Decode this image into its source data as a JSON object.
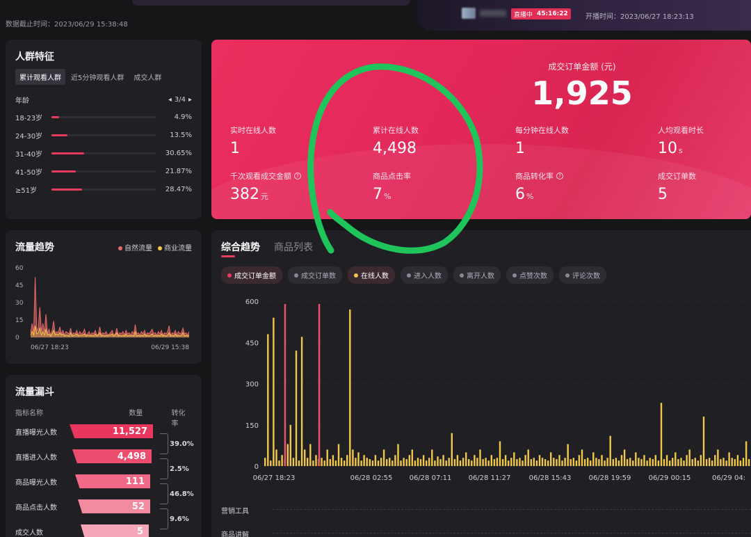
{
  "header": {
    "cutoff_time": "数据截止时间：2023/06/29 15:38:48",
    "live_status": "直播中",
    "live_timer": "45:16:22",
    "start_time": "开播时间：2023/06/27 18:23:13"
  },
  "crowd": {
    "title": "人群特征",
    "tabs": [
      "累计观看人群",
      "近5分钟观看人群",
      "成交人群"
    ],
    "active_tab": 0,
    "section_label": "年龄",
    "pager": "3/4",
    "rows": [
      {
        "label": "18-23岁",
        "pct": "4.9%",
        "value": 4.9
      },
      {
        "label": "24-30岁",
        "pct": "13.5%",
        "value": 13.5
      },
      {
        "label": "31-40岁",
        "pct": "30.65%",
        "value": 30.65
      },
      {
        "label": "41-50岁",
        "pct": "21.87%",
        "value": 21.87
      },
      {
        "label": "≥51岁",
        "pct": "28.47%",
        "value": 28.47
      }
    ]
  },
  "hero": {
    "big_label": "成交订单金额 (元)",
    "big_value": "1,925",
    "metrics": [
      {
        "label": "实时在线人数",
        "value": "1",
        "unit": "",
        "help": false
      },
      {
        "label": "累计在线人数",
        "value": "4,498",
        "unit": "",
        "help": false
      },
      {
        "label": "每分钟在线人数",
        "value": "1",
        "unit": "",
        "help": false
      },
      {
        "label": "人均观看时长",
        "value": "10",
        "unit": "s",
        "help": false
      },
      {
        "label": "千次观看成交金额",
        "value": "382",
        "unit": "元",
        "help": true
      },
      {
        "label": "商品点击率",
        "value": "7",
        "unit": "%",
        "help": false
      },
      {
        "label": "商品转化率",
        "value": "6",
        "unit": "%",
        "help": true
      },
      {
        "label": "成交订单数",
        "value": "5",
        "unit": "",
        "help": false
      }
    ]
  },
  "traffic": {
    "title": "流量趋势",
    "legend": [
      {
        "name": "自然流量",
        "color": "#e86a6a"
      },
      {
        "name": "商业流量",
        "color": "#f2c84b"
      }
    ],
    "x_start": "06/27 18:23",
    "x_end": "06/29 15:38"
  },
  "funnel": {
    "title": "流量漏斗",
    "col_name": "指标名称",
    "col_count": "数量",
    "col_rate": "转化率",
    "rows": [
      {
        "name": "直播曝光人数",
        "value": "11,527"
      },
      {
        "name": "直播进入人数",
        "value": "4,498"
      },
      {
        "name": "商品曝光人数",
        "value": "111"
      },
      {
        "name": "商品点击人数",
        "value": "52"
      },
      {
        "name": "成交人数",
        "value": "5"
      }
    ],
    "rates": [
      "39.0%",
      "2.5%",
      "46.8%",
      "9.6%"
    ]
  },
  "main": {
    "tabs": [
      "综合趋势",
      "商品列表"
    ],
    "chips": [
      {
        "label": "成交订单金额",
        "color": "#e83b5d",
        "selected": true
      },
      {
        "label": "成交订单数",
        "color": "#8a8a93",
        "selected": false
      },
      {
        "label": "在线人数",
        "color": "#f2c84b",
        "selected": true
      },
      {
        "label": "进入人数",
        "color": "#8a8a93",
        "selected": false
      },
      {
        "label": "离开人数",
        "color": "#8a8a93",
        "selected": false
      },
      {
        "label": "点赞次数",
        "color": "#8a8a93",
        "selected": false
      },
      {
        "label": "评论次数",
        "color": "#8a8a93",
        "selected": false
      }
    ],
    "bottom_rows": [
      "营销工具",
      "商品讲解"
    ]
  },
  "chart_data": [
    {
      "type": "line",
      "title": "流量趋势",
      "ylim": [
        0,
        60
      ],
      "y_ticks": [
        "60",
        "45",
        "30",
        "15",
        "0"
      ],
      "x_labels": [
        "06/27 18:23",
        "06/29 15:38"
      ],
      "series": [
        {
          "name": "自然流量",
          "values": [
            4,
            12,
            3,
            52,
            6,
            8,
            26,
            5,
            12,
            4,
            20,
            3,
            7,
            2,
            6,
            14,
            3,
            5,
            4,
            9,
            3,
            6,
            2,
            5,
            4,
            3,
            8,
            2,
            4,
            3,
            6,
            2,
            5,
            3,
            4,
            7,
            2,
            3,
            5,
            2,
            4,
            3,
            6,
            2,
            3,
            9,
            2,
            4,
            3,
            5,
            2,
            3,
            4,
            6,
            2,
            3,
            8,
            2,
            4,
            3,
            5,
            2,
            6,
            3,
            4,
            2,
            5,
            3,
            11,
            3,
            4,
            2,
            5,
            3,
            6,
            2,
            4,
            3,
            5,
            7,
            3,
            4,
            2,
            5,
            3,
            6,
            2,
            4,
            3,
            5,
            10,
            2,
            4,
            3,
            6,
            2,
            5,
            3,
            4,
            8,
            3,
            4,
            2,
            5
          ]
        },
        {
          "name": "商业流量",
          "values": [
            2,
            5,
            2,
            10,
            3,
            4,
            8,
            2,
            5,
            2,
            7,
            2,
            3,
            1,
            3,
            6,
            2,
            3,
            2,
            4,
            2,
            3,
            1,
            2,
            2,
            1,
            4,
            1,
            2,
            2,
            3,
            1,
            2,
            2,
            2,
            3,
            1,
            2,
            2,
            1,
            2,
            1,
            3,
            1,
            2,
            4,
            1,
            2,
            1,
            2,
            1,
            2,
            2,
            3,
            1,
            2,
            4,
            1,
            2,
            1,
            2,
            1,
            3,
            1,
            2,
            1,
            2,
            1,
            5,
            1,
            2,
            1,
            2,
            1,
            3,
            1,
            2,
            1,
            2,
            3,
            1,
            2,
            1,
            2,
            1,
            3,
            1,
            2,
            1,
            2,
            4,
            1,
            2,
            1,
            3,
            1,
            2,
            1,
            2,
            4,
            1,
            2,
            1,
            2
          ]
        }
      ]
    },
    {
      "type": "bar",
      "title": "综合趋势",
      "ylim": [
        0,
        600
      ],
      "y_ticks": [
        "600",
        "450",
        "300",
        "150",
        "0"
      ],
      "x_labels": [
        "06/27 18:23",
        "06/28 02:55",
        "06/28 07:11",
        "06/28 11:27",
        "06/28 15:43",
        "06/28 19:59",
        "06/29 00:15",
        "06/29 04:"
      ],
      "series": [
        {
          "name": "成交订单金额",
          "values": [
            0,
            0,
            0,
            0,
            0,
            0,
            0,
            590,
            0,
            0,
            0,
            0,
            0,
            0,
            0,
            0,
            0,
            0,
            0,
            590,
            0,
            0,
            0,
            0,
            0,
            0,
            0,
            0,
            0,
            0,
            0,
            0,
            0,
            0,
            0,
            0,
            0,
            0,
            0,
            0,
            0,
            0,
            0,
            0,
            0,
            0,
            0,
            0,
            0,
            0,
            0,
            0,
            0,
            0,
            0,
            0,
            0,
            0,
            0,
            0,
            0,
            0,
            0,
            0,
            0,
            0,
            0,
            0,
            0,
            0,
            0,
            0,
            0,
            0,
            0,
            0,
            0,
            0,
            0,
            0,
            0,
            0,
            0,
            0,
            0,
            0,
            0,
            0,
            0,
            0,
            0,
            0,
            0,
            0,
            0,
            0,
            0,
            0,
            0,
            0,
            0,
            0,
            0,
            0,
            0,
            0,
            0,
            0,
            0,
            0,
            0,
            0,
            0,
            0,
            0,
            0,
            0,
            0,
            0,
            0,
            0,
            0,
            0,
            0,
            0,
            0,
            0,
            0,
            0,
            0,
            0,
            0,
            0,
            0,
            0,
            0,
            0,
            0,
            0,
            0,
            0,
            0,
            0,
            0,
            0,
            0,
            0,
            0,
            0,
            0,
            0,
            0,
            0,
            0,
            0,
            0,
            0,
            0,
            0,
            0,
            0,
            0,
            0,
            0,
            0,
            0,
            0,
            0,
            0,
            0,
            0
          ]
        },
        {
          "name": "在线人数",
          "values": [
            30,
            480,
            20,
            540,
            60,
            20,
            40,
            25,
            80,
            150,
            30,
            420,
            20,
            470,
            60,
            30,
            80,
            20,
            40,
            25,
            30,
            20,
            60,
            25,
            40,
            20,
            80,
            30,
            20,
            40,
            570,
            60,
            30,
            50,
            20,
            40,
            30,
            25,
            20,
            40,
            20,
            30,
            60,
            25,
            30,
            20,
            40,
            80,
            20,
            30,
            25,
            40,
            60,
            20,
            30,
            25,
            40,
            20,
            30,
            60,
            20,
            35,
            25,
            40,
            20,
            30,
            120,
            25,
            40,
            20,
            30,
            50,
            25,
            20,
            40,
            30,
            60,
            25,
            30,
            20,
            40,
            25,
            30,
            90,
            25,
            40,
            20,
            30,
            50,
            25,
            30,
            20,
            40,
            60,
            25,
            30,
            20,
            40,
            30,
            25,
            20,
            50,
            30,
            25,
            40,
            20,
            30,
            80,
            25,
            30,
            20,
            40,
            60,
            25,
            30,
            20,
            50,
            30,
            25,
            40,
            20,
            30,
            110,
            25,
            30,
            20,
            40,
            60,
            25,
            30,
            20,
            50,
            30,
            25,
            40,
            20,
            30,
            25,
            40,
            20,
            230,
            25,
            40,
            20,
            30,
            50,
            25,
            30,
            20,
            40,
            60,
            25,
            30,
            20,
            40,
            180,
            25,
            30,
            20,
            40,
            60,
            25,
            30,
            20,
            50,
            30,
            25,
            40,
            20,
            30,
            90,
            25
          ]
        }
      ]
    }
  ]
}
